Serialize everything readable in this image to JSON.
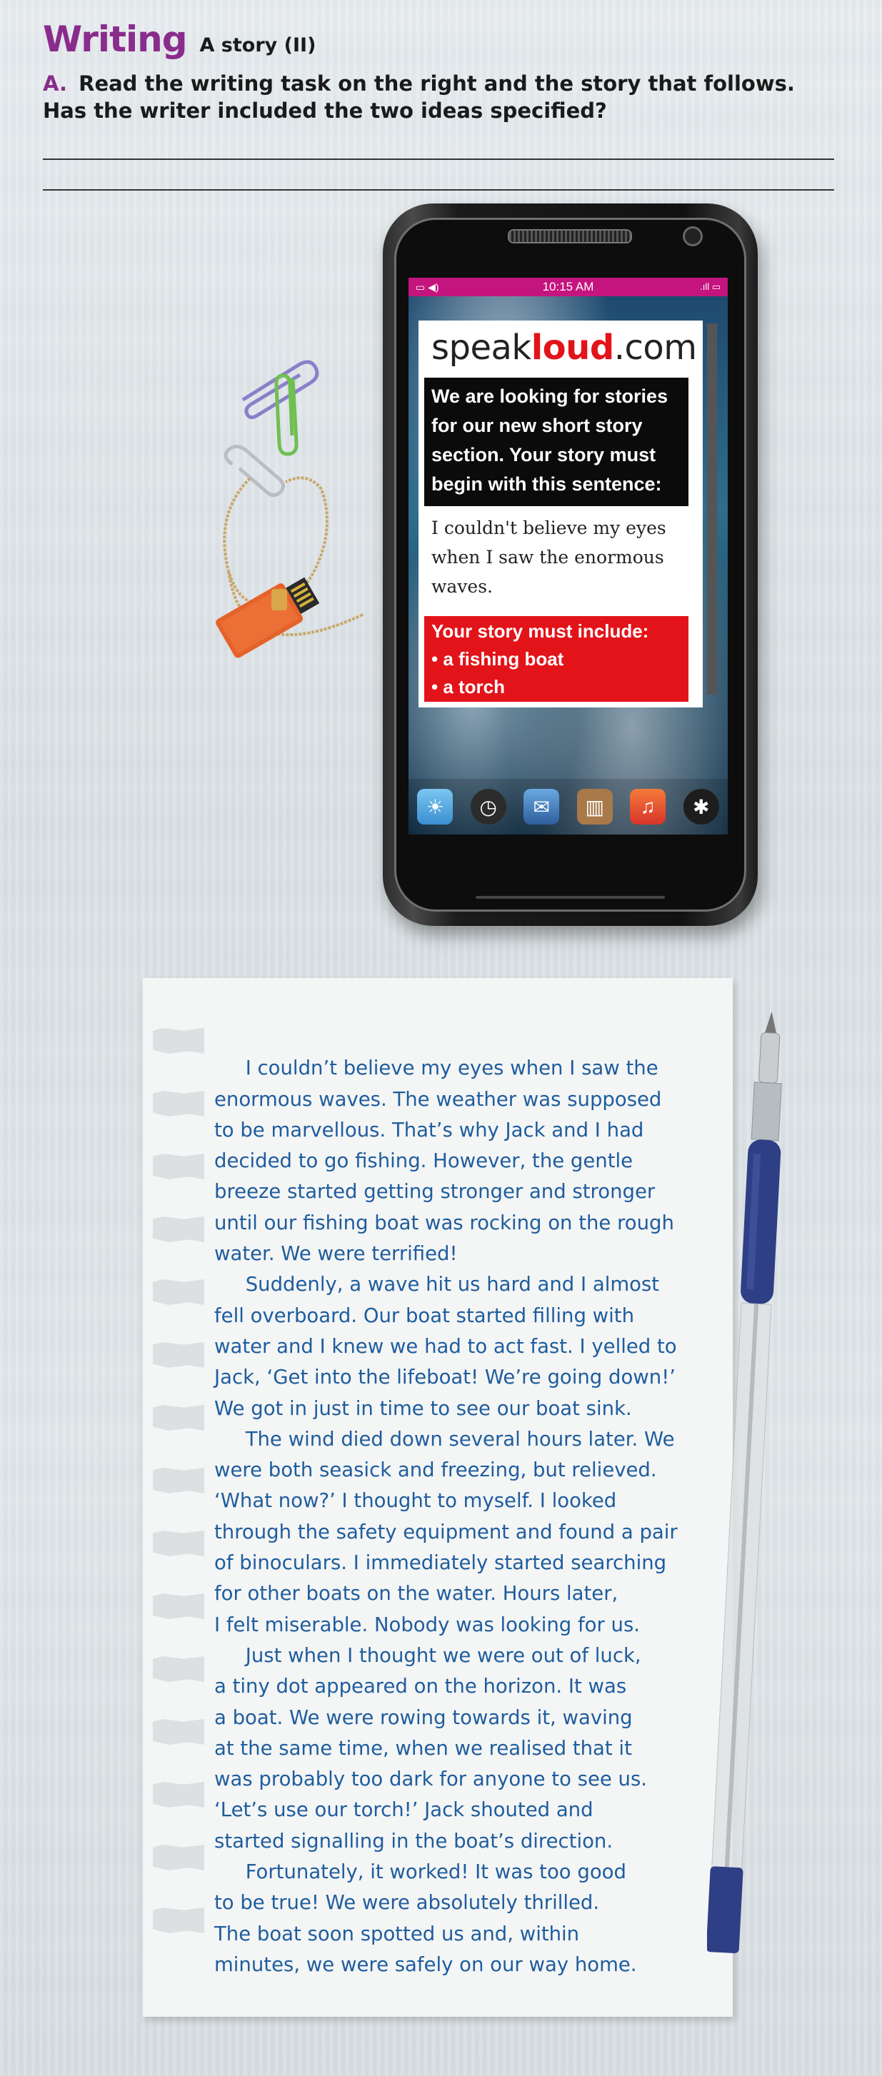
{
  "header": {
    "title": "Writing",
    "subtitle": "A story (II)",
    "task_letter": "A.",
    "task_text": "Read the writing task on the right and the story that follows. Has the writer included the two ideas specified?"
  },
  "phone": {
    "status_time": "10:15 AM",
    "site_logo_a": "speak",
    "site_logo_b": "loud",
    "site_logo_c": ".com",
    "black_box_lines": [
      "We are looking for stories",
      "for our new short story",
      "section. Your story must",
      "begin with this sentence:"
    ],
    "story_start_lines": [
      "I couldn't believe my eyes",
      "when I saw the enormous",
      "waves."
    ],
    "red_box_lines": [
      "Your story must include:",
      "• a fishing boat",
      "• a torch"
    ],
    "dock_apps": [
      "weather-icon",
      "clock-icon",
      "mail-icon",
      "books-icon",
      "music-icon",
      "settings-icon"
    ]
  },
  "story": {
    "lines": [
      "     I couldn’t believe my eyes when I saw the",
      "enormous waves. The weather was supposed",
      "to be marvellous. That’s why Jack and I had",
      "decided to go fishing. However, the gentle",
      "breeze started getting stronger and stronger",
      "until our fishing boat was rocking on the rough",
      "water. We were terrified!",
      "     Suddenly, a wave hit us hard and I almost",
      "fell overboard. Our boat started filling with",
      "water and I knew we had to act fast. I yelled to",
      "Jack, ‘Get into the lifeboat! We’re going down!’",
      "We got in just in time to see our boat sink.",
      "     The wind died down several hours later. We",
      "were both seasick and freezing, but relieved.",
      "‘What now?’ I thought to myself. I looked",
      "through the safety equipment and found a pair",
      "of binoculars. I immediately started searching",
      "for other boats on the water. Hours later,",
      "I felt miserable. Nobody was looking for us.",
      "     Just when I thought we were out of luck,",
      "a tiny dot appeared on the horizon. It was",
      "a boat. We were rowing towards it, waving",
      "at the same time, when we realised that it",
      "was probably too dark for anyone to see us.",
      "‘Let’s use our torch!’ Jack shouted and",
      "started signalling in the boat’s direction.",
      "     Fortunately, it worked! It was too good",
      "to be true! We were absolutely thrilled.",
      "The boat soon spotted us and, within",
      "minutes, we were safely on our way home."
    ]
  },
  "colors": {
    "accent_purple": "#8a2c8c",
    "story_blue": "#1e5d9e",
    "status_pink": "#c4147d",
    "red_box": "#e3131a"
  }
}
